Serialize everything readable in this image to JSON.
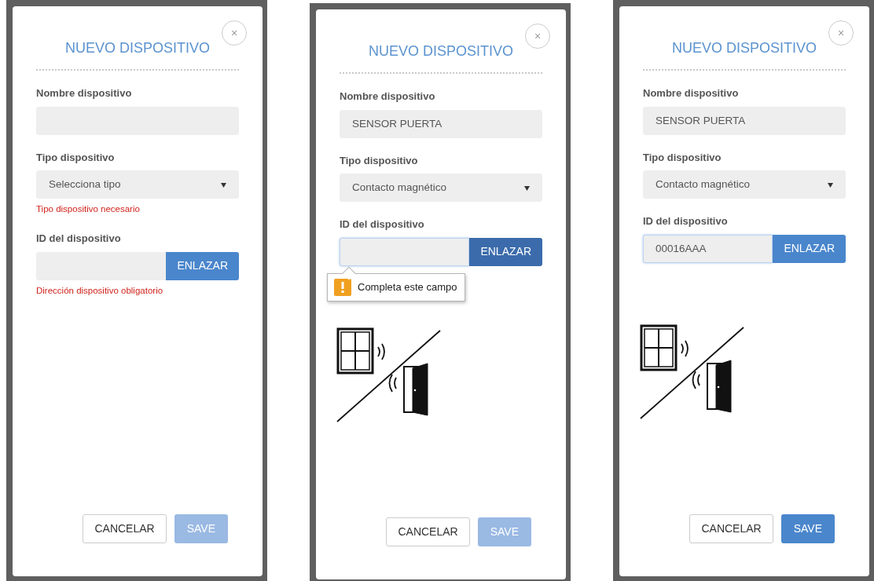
{
  "panels": [
    {
      "title": "NUEVO DISPOSITIVO",
      "close": "×",
      "fields": [
        {
          "kind": "text",
          "label": "Nombre dispositivo"
        },
        {
          "kind": "select",
          "label": "Tipo dispositivo",
          "placeholder": "Selecciona tipo",
          "error": "Tipo dispositivo necesario"
        },
        {
          "kind": "link",
          "label": "ID del dispositivo",
          "button": "ENLAZAR",
          "pressed": false,
          "focused": false,
          "error": "Dirección dispositivo obligatorio"
        }
      ],
      "buttons": [
        {
          "label": "CANCELAR",
          "kind": "secondary",
          "disabled": false
        },
        {
          "label": "SAVE",
          "kind": "primary",
          "disabled": true
        }
      ]
    },
    {
      "title": "NUEVO DISPOSITIVO",
      "close": "×",
      "fields": [
        {
          "kind": "text",
          "label": "Nombre dispositivo",
          "value": "SENSOR PUERTA"
        },
        {
          "kind": "select",
          "label": "Tipo dispositivo",
          "value": "Contacto magnético"
        },
        {
          "kind": "link",
          "label": "ID del dispositivo",
          "button": "ENLAZAR",
          "pressed": true,
          "focused": true,
          "tooltip": "Completa este campo"
        }
      ],
      "illustration": {
        "kind": "window-door"
      },
      "buttons": [
        {
          "label": "CANCELAR",
          "kind": "secondary",
          "disabled": false
        },
        {
          "label": "SAVE",
          "kind": "primary",
          "disabled": true
        }
      ]
    },
    {
      "title": "NUEVO DISPOSITIVO",
      "close": "×",
      "fields": [
        {
          "kind": "text",
          "label": "Nombre dispositivo",
          "value": "SENSOR PUERTA"
        },
        {
          "kind": "select",
          "label": "Tipo dispositivo",
          "value": "Contacto magnético"
        },
        {
          "kind": "link",
          "label": "ID del dispositivo",
          "button": "ENLAZAR",
          "pressed": false,
          "focused": true,
          "value": "00016AAA"
        }
      ],
      "illustration": {
        "kind": "window-door"
      },
      "buttons": [
        {
          "label": "CANCELAR",
          "kind": "secondary",
          "disabled": false
        },
        {
          "label": "SAVE",
          "kind": "primary",
          "disabled": false
        }
      ]
    }
  ]
}
